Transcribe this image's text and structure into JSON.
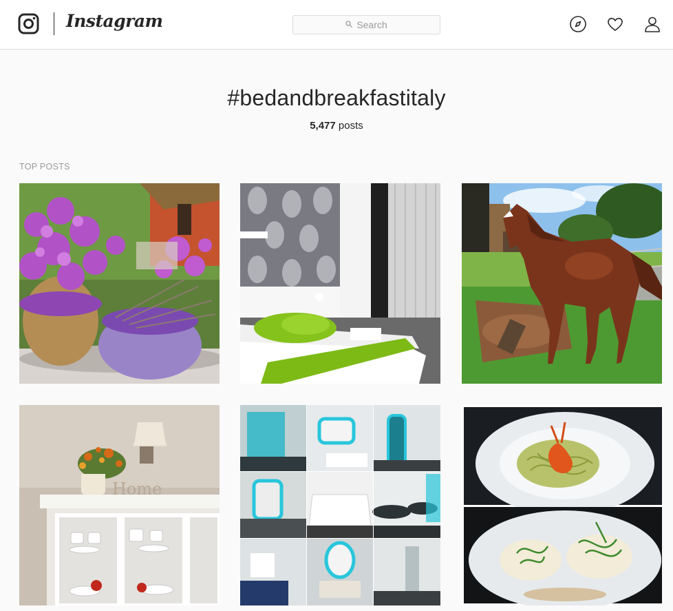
{
  "nav": {
    "wordmark": "Instagram",
    "search_placeholder": "Search",
    "icons": [
      "instagram-glyph-icon",
      "compass-icon",
      "heart-icon",
      "profile-icon"
    ]
  },
  "header": {
    "hashtag": "#bedandbreakfastitaly",
    "post_count": "5,477",
    "post_count_suffix": " posts"
  },
  "section": {
    "label": "TOP POSTS"
  },
  "posts": [
    {
      "subject": "flowers-and-lavender-baskets"
    },
    {
      "subject": "hotel-bedroom-green-throw"
    },
    {
      "subject": "chestnut-horse-pasture"
    },
    {
      "subject": "white-cabinet-home-decor"
    },
    {
      "subject": "modern-room-collage"
    },
    {
      "subject": "pasta-and-seafood-plates"
    }
  ],
  "colors": {
    "text": "#262626",
    "muted": "#999999",
    "border": "#dbdbdb",
    "page_bg": "#fafafa"
  }
}
